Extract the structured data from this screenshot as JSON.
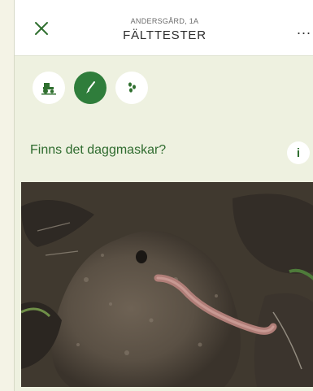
{
  "header": {
    "close_label": "×",
    "subtitle": "ANDERSGÅRD, 1A",
    "title": "FÄLTTESTER",
    "more_label": "..."
  },
  "tools": [
    {
      "icon": "tractor-icon",
      "active": false
    },
    {
      "icon": "shovel-icon",
      "active": true
    },
    {
      "icon": "seeds-icon",
      "active": false
    }
  ],
  "question": {
    "text": "Finns det daggmaskar?",
    "info_label": "i"
  },
  "photo": {
    "subject": "earthworm-on-soil"
  },
  "colors": {
    "accent": "#2f7d3b",
    "background": "#eef1e0",
    "question_text": "#2e6b2e"
  }
}
